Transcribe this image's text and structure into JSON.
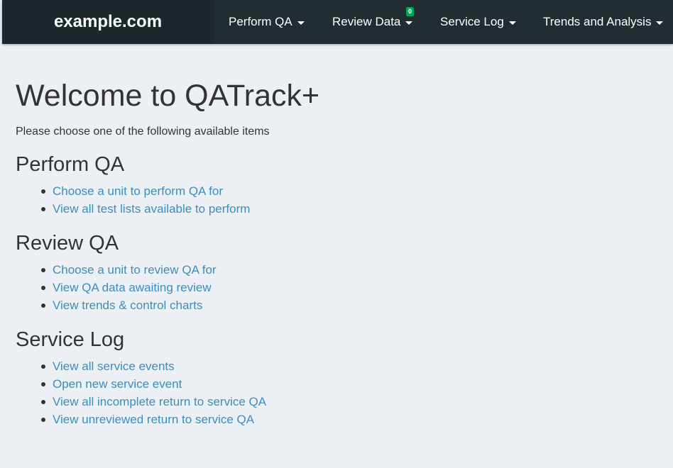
{
  "navbar": {
    "brand": "example.com",
    "items": [
      {
        "label": "Perform QA"
      },
      {
        "label": "Review Data",
        "badge": "0"
      },
      {
        "label": "Service Log"
      },
      {
        "label": "Trends and Analysis"
      }
    ]
  },
  "main": {
    "title": "Welcome to QATrack+",
    "intro": "Please choose one of the following available items",
    "sections": [
      {
        "heading": "Perform QA",
        "links": [
          "Choose a unit to perform QA for",
          "View all test lists available to perform"
        ]
      },
      {
        "heading": "Review QA",
        "links": [
          "Choose a unit to review QA for",
          "View QA data awaiting review",
          "View trends & control charts"
        ]
      },
      {
        "heading": "Service Log",
        "links": [
          "View all service events",
          "Open new service event",
          "View all incomplete return to service QA",
          "View unreviewed return to service QA"
        ]
      }
    ]
  },
  "colors": {
    "navbar": "#222d32",
    "brand_bg": "#1e282c",
    "page_bg": "#ecf0f5",
    "link": "#3c8dbc",
    "badge": "#00a65a"
  }
}
